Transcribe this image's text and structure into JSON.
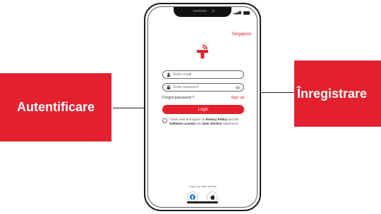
{
  "callouts": {
    "left": "Autentificare",
    "right": "Înregistrare"
  },
  "screen": {
    "region": "Singapore",
    "email_placeholder": "Enter email",
    "password_placeholder": "Enter password",
    "forgot_password": "Forgot password ?",
    "sign_up": "Sign up",
    "login_label": "Login",
    "terms": {
      "prefix": "I have read and agree on ",
      "privacy": "Privacy Policy",
      "mid": " and the ",
      "license": "Software License",
      "and": " and ",
      "user_service": "User Service",
      "suffix": " Agreement."
    },
    "social_label": "Log in by other means"
  },
  "colors": {
    "brand_red": "#e3202d"
  },
  "icons": [
    "user-icon",
    "lock-icon",
    "eye-icon",
    "logo-icon",
    "facebook-icon",
    "apple-icon"
  ]
}
